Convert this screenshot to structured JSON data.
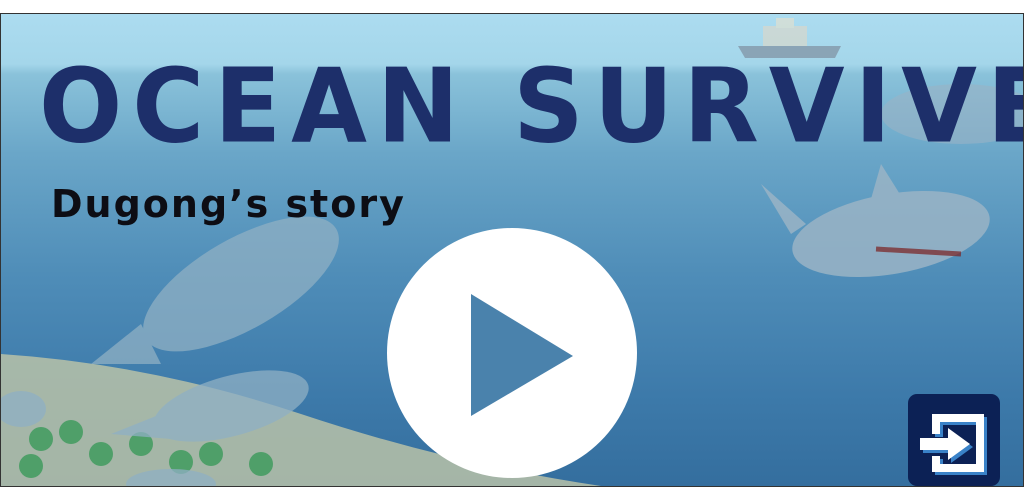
{
  "game": {
    "title": "OCEAN SURVIVE",
    "subtitle": "Dugong’s story"
  },
  "controls": {
    "play_icon": "play-icon",
    "exit_icon": "exit-icon"
  },
  "colors": {
    "title": "#1d2f6a",
    "exit_button": "#0c2155",
    "play_triangle": "#4a82ac"
  }
}
